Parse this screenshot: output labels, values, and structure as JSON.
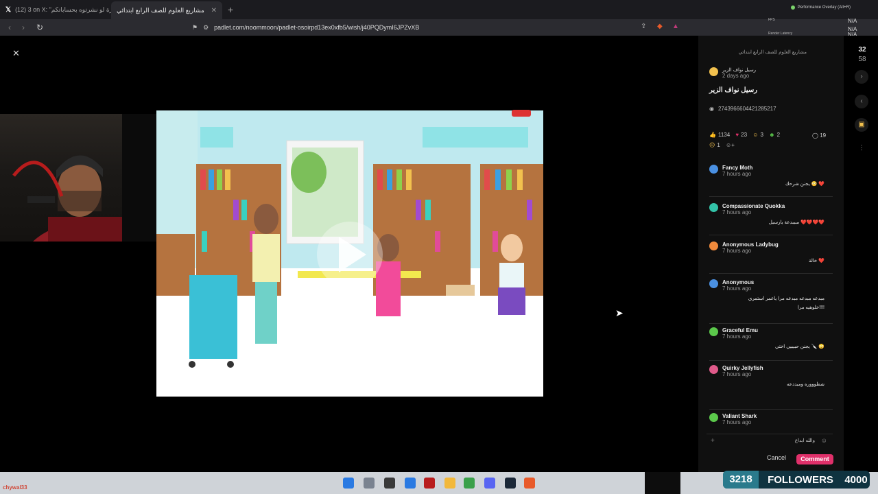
{
  "browser": {
    "tabs": [
      {
        "label": "(12) 3 on X: \"ذاكرة لو نشرتوه بحساباتكم\"",
        "icon": "x-logo-icon",
        "active": false
      },
      {
        "label": "مشاريع العلوم للصف الرابع ابتدائي",
        "icon": "padlet-icon",
        "active": true
      }
    ],
    "new_tab_label": "+",
    "url": "padlet.com/noommoon/padlet-osoirpd13ex0xfb5/wish/j40PQDymI6JPZvXB",
    "overlay_label": "Performance Overlay (Alt+R)",
    "fps_label": "FPS",
    "render_latency_label": "Render Latency",
    "na_1": "N/A",
    "na_2": "N/A",
    "na_3": "N/A"
  },
  "post": {
    "breadcrumb": "مشاريع العلوم للصف الرابع ابتدائي",
    "author_name": "رسيل نواف الزير",
    "author_time": "2 days ago",
    "title": "رسيل نواف الزير",
    "id": "2743966604421285217",
    "reactions": [
      {
        "icon": "thumbs-up-icon",
        "count": "1134",
        "color": "#f2c14e"
      },
      {
        "icon": "heart-icon",
        "count": "23",
        "color": "#e0306a"
      },
      {
        "icon": "laugh-icon",
        "count": "3",
        "color": "#f2c14e"
      },
      {
        "icon": "sick-face-icon",
        "count": "2",
        "color": "#5bc84b"
      },
      {
        "icon": "cry-face-icon",
        "count": "1",
        "color": "#f2c14e"
      }
    ],
    "comment_count": "19",
    "views_top": "32",
    "views_bottom": "58"
  },
  "comments": [
    {
      "name": "Fancy Moth",
      "time": "7 hours ago",
      "body": "يجنن شرحك 😳 ❤️",
      "color": "#4a90e2"
    },
    {
      "name": "Compassionate Quokka",
      "time": "7 hours ago",
      "body": "مبببدعة يارسيل ❤️❤️❤️❤️",
      "color": "#33c3a8"
    },
    {
      "name": "Anonymous Ladybug",
      "time": "7 hours ago",
      "body": "خالة ❤️",
      "color": "#f08a3c"
    },
    {
      "name": "Anonymous",
      "time": "7 hours ago",
      "body": "مبدعه مبدعه مبدعه مرا ياعمر استمري خلوهيه مرا!!!!",
      "color": "#4a90e2"
    },
    {
      "name": "Graceful Emu",
      "time": "7 hours ago",
      "body": "يجنن حبيبيي اختي 🔪 😳",
      "color": "#5bc84b"
    },
    {
      "name": "Quirky Jellyfish",
      "time": "7 hours ago",
      "body": "شطوووره ومبددعه",
      "color": "#e05a8a"
    },
    {
      "name": "Valiant Shark",
      "time": "7 hours ago",
      "body": "",
      "color": "#5bc84b"
    }
  ],
  "composer": {
    "text": "والله ابداع",
    "cancel_label": "Cancel",
    "submit_label": "Comment"
  },
  "stream": {
    "followers_count": "3218",
    "followers_label": "FOLLOWERS",
    "followers_goal": "4000",
    "username": "chywal33"
  },
  "colors": {
    "accent": "#e0306a",
    "panel": "#101010",
    "followers_bg": "#0f3340"
  }
}
